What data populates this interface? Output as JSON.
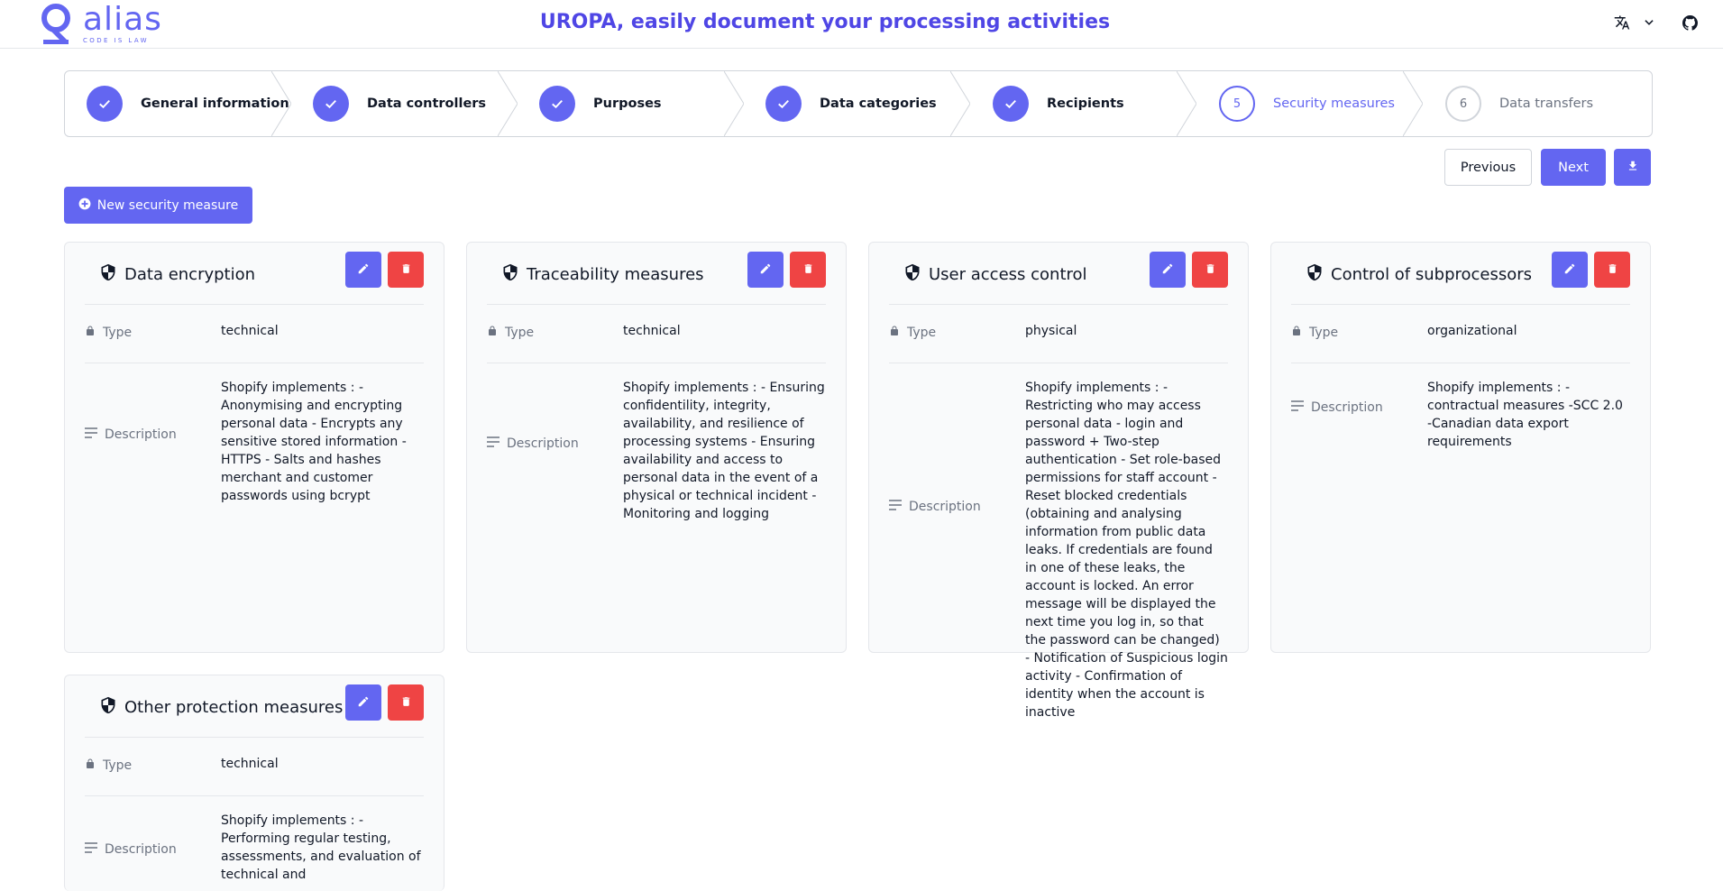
{
  "brand": {
    "name": "alias",
    "tagline": "CODE IS LAW",
    "color": "#6366f1"
  },
  "header": {
    "title": "UROPA, easily document your processing activities",
    "translate_icon": "translate-icon",
    "chevron_icon": "chevron-down-icon",
    "github_icon": "github-icon"
  },
  "stepper": {
    "steps": [
      {
        "label": "General information",
        "status": "done"
      },
      {
        "label": "Data controllers",
        "status": "done"
      },
      {
        "label": "Purposes",
        "status": "done"
      },
      {
        "label": "Data categories",
        "status": "done"
      },
      {
        "label": "Recipients",
        "status": "done"
      },
      {
        "number": "5",
        "label": "Security measures",
        "status": "current"
      },
      {
        "number": "6",
        "label": "Data transfers",
        "status": "todo"
      }
    ]
  },
  "nav": {
    "previous": "Previous",
    "next": "Next",
    "download_icon": "download-icon"
  },
  "actions": {
    "new_measure": "New security measure"
  },
  "labels": {
    "type": "Type",
    "description": "Description"
  },
  "measures": [
    {
      "title": "Data encryption",
      "type": "technical",
      "description": "Shopify implements : - Anonymising and encrypting personal data - Encrypts any sensitive stored information - HTTPS - Salts and hashes merchant and customer passwords using bcrypt"
    },
    {
      "title": "Traceability measures",
      "type": "technical",
      "description": "Shopify implements : - Ensuring confidentility, integrity, availability, and resilience of processing systems - Ensuring availability and access to personal data in the event of a physical or technical incident - Monitoring and logging"
    },
    {
      "title": "User access control",
      "type": "physical",
      "description": "Shopify implements : - Restricting who may access personal data - login and password + Two-step authentication - Set role-based permissions for staff account - Reset blocked credentials (obtaining and analysing information from public data leaks. If credentials are found in one of these leaks, the account is locked. An error message will be displayed the next time you log in, so that the password can be changed) - Notification of Suspicious login activity - Confirmation of identity when the account is inactive"
    },
    {
      "title": "Control of subprocessors",
      "type": "organizational",
      "description": "Shopify implements : -contractual measures -SCC 2.0 -Canadian data export requirements"
    },
    {
      "title": "Other protection measures",
      "type": "technical",
      "description": "Shopify implements : - Performing regular testing, assessments, and evaluation of technical and"
    }
  ]
}
